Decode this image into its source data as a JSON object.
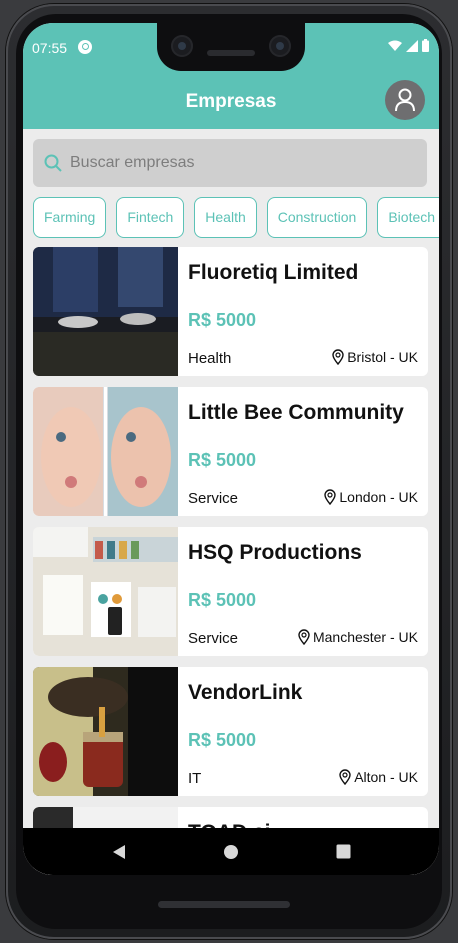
{
  "status_bar": {
    "time": "07:55"
  },
  "header": {
    "title": "Empresas",
    "profile_icon": "user-icon"
  },
  "search": {
    "placeholder": "Buscar empresas",
    "value": ""
  },
  "categories": [
    "Farming",
    "Fintech",
    "Health",
    "Construction",
    "Biotech"
  ],
  "companies": [
    {
      "name": "Fluoretiq Limited",
      "price": "R$ 5000",
      "category": "Health",
      "location": "Bristol - UK"
    },
    {
      "name": "Little Bee Community",
      "price": "R$ 5000",
      "category": "Service",
      "location": "London - UK"
    },
    {
      "name": "HSQ Productions",
      "price": "R$ 5000",
      "category": "Service",
      "location": "Manchester - UK"
    },
    {
      "name": "VendorLink",
      "price": "R$ 5000",
      "category": "IT",
      "location": "Alton - UK"
    },
    {
      "name": "TOAD.ai",
      "price": "",
      "category": "",
      "location": ""
    }
  ],
  "colors": {
    "accent": "#5cc2b6",
    "background": "#ececec",
    "card": "#ffffff"
  },
  "nav": {
    "icons": [
      "back-icon",
      "home-icon",
      "recents-icon"
    ]
  }
}
